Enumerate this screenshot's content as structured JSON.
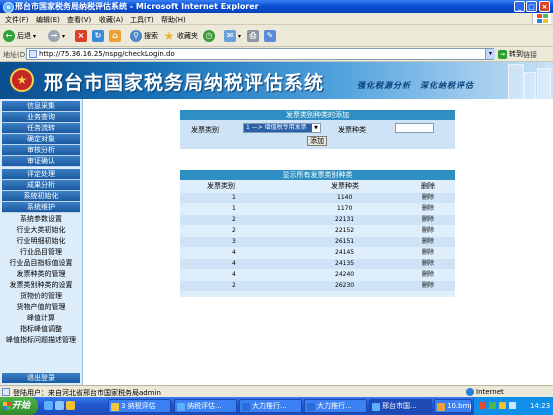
{
  "window": {
    "title": "邢台市国家税务局纳税评估系统 - Microsoft Internet Explorer"
  },
  "menubar": {
    "items": [
      "文件(F)",
      "编辑(E)",
      "查看(V)",
      "收藏(A)",
      "工具(T)",
      "帮助(H)"
    ]
  },
  "toolbar": {
    "back": "后退",
    "search": "搜索",
    "favorites": "收藏夹"
  },
  "addressbar": {
    "label": "地址(D)",
    "url": "http://75.36.16.25/nspg/checkLogin.do",
    "go": "转到",
    "links": "链接"
  },
  "banner": {
    "title": "邢台市国家税务局纳税评估系统",
    "slogan": "强化税源分析　深化纳税评估"
  },
  "sidebar": {
    "menu": [
      "信息采集",
      "业务查询",
      "任务流转",
      "确定对象",
      "审核分析",
      "审证确认",
      "评定处理",
      "成果分析",
      "系统初始化",
      "系统维护"
    ],
    "submenu": [
      "系统参数设置",
      "行业大类初始化",
      "行业明细初始化",
      "行业品目管理",
      "行业品目指标值设置",
      "发票种类的管理",
      "发票类别种类的设置",
      "货物价的管理",
      "货物产值的管理",
      "峰值计算",
      "指标峰值调整",
      "峰值指标问题描述管理"
    ],
    "logout": "退出登录"
  },
  "add_form": {
    "header": "发票类别种类的添加",
    "type_label": "发票类别",
    "type_value": "1 —> 增值税专用发票",
    "species_label": "发票种类",
    "species_value": "",
    "submit": "添加"
  },
  "list": {
    "header": "显示所有发票类别种类",
    "columns": [
      "发票类别",
      "发票种类",
      "删除"
    ],
    "rows": [
      [
        "1",
        "1140",
        "删除"
      ],
      [
        "1",
        "1170",
        "删除"
      ],
      [
        "2",
        "22131",
        "删除"
      ],
      [
        "2",
        "22152",
        "删除"
      ],
      [
        "3",
        "26151",
        "删除"
      ],
      [
        "4",
        "24145",
        "删除"
      ],
      [
        "4",
        "24135",
        "删除"
      ],
      [
        "4",
        "24240",
        "删除"
      ],
      [
        "2",
        "26230",
        "删除"
      ]
    ]
  },
  "statusbar": {
    "text": "登陆用户：来自河北省邢台市国家税务局admin",
    "zone": "Internet"
  },
  "taskbar": {
    "start": "开始",
    "tasks": [
      "3 纳税评估",
      "纳税评估...",
      "大力推行...",
      "大力推行...",
      "邢台市国...",
      "10.bmp - ..."
    ],
    "clock": "14:23"
  }
}
